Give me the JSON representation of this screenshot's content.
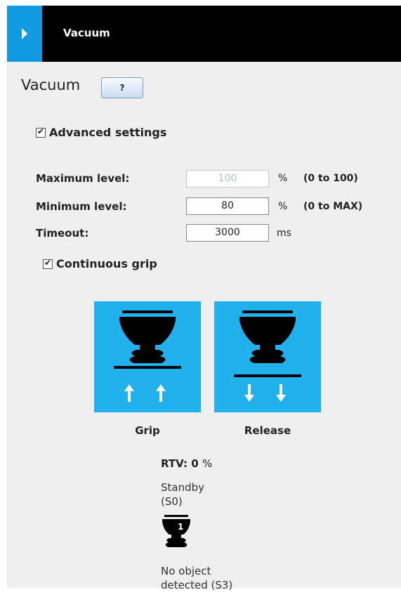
{
  "header": {
    "title": "Vacuum"
  },
  "section": {
    "title": "Vacuum",
    "help_label": "?"
  },
  "advanced": {
    "label": "Advanced settings",
    "checked": true
  },
  "fields": [
    {
      "label": "Maximum level:",
      "value": "100",
      "unit": "%",
      "range": "(0 to 100)",
      "disabled": true
    },
    {
      "label": "Minimum level:",
      "value": "80",
      "unit": "%",
      "range": "(0 to MAX)",
      "disabled": false
    },
    {
      "label": "Timeout:",
      "value": "3000",
      "unit": "ms",
      "range": "",
      "disabled": false
    }
  ],
  "continuous": {
    "label": "Continuous grip",
    "checked": true
  },
  "actions": {
    "grip_label": "Grip",
    "release_label": "Release"
  },
  "status": {
    "rtv_label": "RTV:",
    "rtv_value": "0",
    "rtv_unit": "%",
    "state_line1": "Standby",
    "state_line2": "(S0)",
    "cup_number": "1",
    "object_line1": "No object",
    "object_line2": "detected (S3)"
  },
  "colors": {
    "accent": "#119ae0",
    "button_bg": "#21b1ec",
    "header_bg": "#000000"
  }
}
